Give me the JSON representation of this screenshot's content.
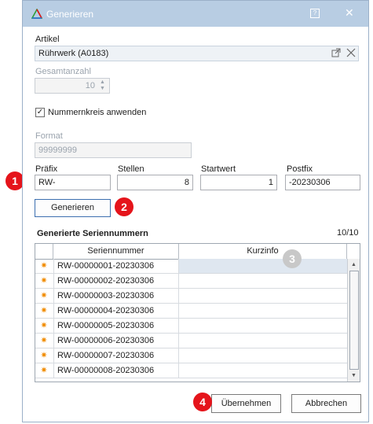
{
  "dialog": {
    "title": "Generieren",
    "help": "?",
    "close": "✕"
  },
  "artikel": {
    "label": "Artikel",
    "value": "Rührwerk (A0183)"
  },
  "gesamtanzahl": {
    "label": "Gesamtanzahl",
    "value": "10"
  },
  "nummernkreis": {
    "label": "Nummernkreis anwenden",
    "checked": true,
    "check_glyph": "✓"
  },
  "format": {
    "label": "Format",
    "value": "99999999"
  },
  "praefix": {
    "label": "Präfix",
    "value": "RW-"
  },
  "stellen": {
    "label": "Stellen",
    "value": "8"
  },
  "startwert": {
    "label": "Startwert",
    "value": "1"
  },
  "postfix": {
    "label": "Postfix",
    "value": "-20230306"
  },
  "buttons": {
    "generieren": "Generieren",
    "uebernehmen": "Übernehmen",
    "abbrechen": "Abbrechen"
  },
  "results": {
    "title": "Generierte Seriennummern",
    "count": "10/10",
    "columns": [
      "Seriennummer",
      "Kurzinfo"
    ],
    "row_icon": "sun-icon",
    "rows": [
      {
        "sn": "RW-00000001-20230306",
        "kurzinfo": ""
      },
      {
        "sn": "RW-00000002-20230306",
        "kurzinfo": ""
      },
      {
        "sn": "RW-00000003-20230306",
        "kurzinfo": ""
      },
      {
        "sn": "RW-00000004-20230306",
        "kurzinfo": ""
      },
      {
        "sn": "RW-00000005-20230306",
        "kurzinfo": ""
      },
      {
        "sn": "RW-00000006-20230306",
        "kurzinfo": ""
      },
      {
        "sn": "RW-00000007-20230306",
        "kurzinfo": ""
      },
      {
        "sn": "RW-00000008-20230306",
        "kurzinfo": ""
      }
    ]
  },
  "badges": [
    "1",
    "2",
    "3",
    "4"
  ],
  "colors": {
    "titlebar": "#b8cde3",
    "badge_red": "#e5141b",
    "badge_gray": "#c8c8c8",
    "row_icon": "#f08a00",
    "focus": "#3c6fb0"
  }
}
